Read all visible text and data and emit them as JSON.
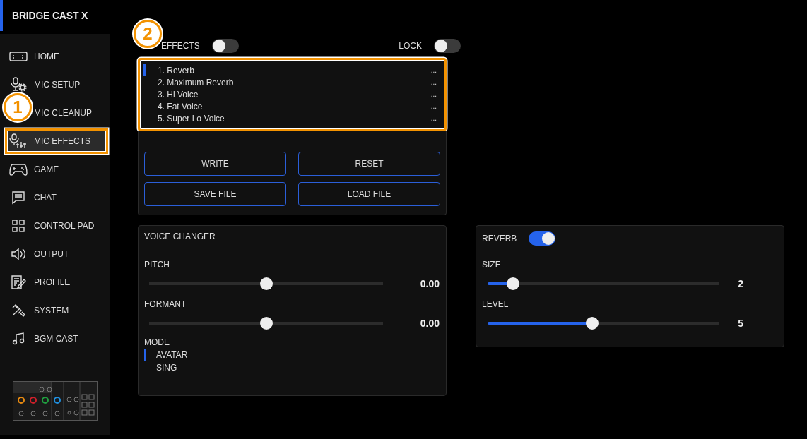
{
  "app": {
    "title": "BRIDGE CAST X"
  },
  "sidebar": {
    "items": [
      {
        "label": "HOME",
        "selected": false,
        "highlighted": false
      },
      {
        "label": "MIC SETUP",
        "selected": false,
        "highlighted": false
      },
      {
        "label": "MIC CLEANUP",
        "selected": false,
        "highlighted": false
      },
      {
        "label": "MIC EFFECTS",
        "selected": true,
        "highlighted": true
      },
      {
        "label": "GAME",
        "selected": false,
        "highlighted": false
      },
      {
        "label": "CHAT",
        "selected": false,
        "highlighted": false
      },
      {
        "label": "CONTROL PAD",
        "selected": false,
        "highlighted": false
      },
      {
        "label": "OUTPUT",
        "selected": false,
        "highlighted": false
      },
      {
        "label": "PROFILE",
        "selected": false,
        "highlighted": false
      },
      {
        "label": "SYSTEM",
        "selected": false,
        "highlighted": false
      },
      {
        "label": "BGM CAST",
        "selected": false,
        "highlighted": false
      }
    ]
  },
  "callouts": [
    {
      "label": "1"
    },
    {
      "label": "2"
    }
  ],
  "effects_toggle": {
    "label": "EFFECTS",
    "on": false
  },
  "lock_toggle": {
    "label": "LOCK",
    "on": false
  },
  "presets": {
    "highlighted": true,
    "items": [
      {
        "name": "1. Reverb",
        "menu": "...",
        "selected": true
      },
      {
        "name": "2. Maximum Reverb",
        "menu": "...",
        "selected": false
      },
      {
        "name": "3. Hi Voice",
        "menu": "...",
        "selected": false
      },
      {
        "name": "4. Fat Voice",
        "menu": "...",
        "selected": false
      },
      {
        "name": "5. Super Lo Voice",
        "menu": "...",
        "selected": false
      }
    ]
  },
  "buttons": [
    "WRITE",
    "RESET",
    "SAVE FILE",
    "LOAD FILE"
  ],
  "voice_changer": {
    "title": "VOICE CHANGER",
    "sliders": [
      {
        "label": "PITCH",
        "level": 0.5,
        "reading": "0.00"
      },
      {
        "label": "FORMANT",
        "level": 0.5,
        "reading": "0.00"
      }
    ],
    "mode": {
      "label": "MODE",
      "options": [
        {
          "label": "AVATAR",
          "selected": true
        },
        {
          "label": "SING",
          "selected": false
        }
      ]
    }
  },
  "reverb": {
    "title": "REVERB",
    "on": true,
    "sliders": [
      {
        "label": "SIZE",
        "level": 0.11,
        "reading": "2"
      },
      {
        "label": "LEVEL",
        "level": 0.45,
        "reading": "5"
      }
    ]
  }
}
